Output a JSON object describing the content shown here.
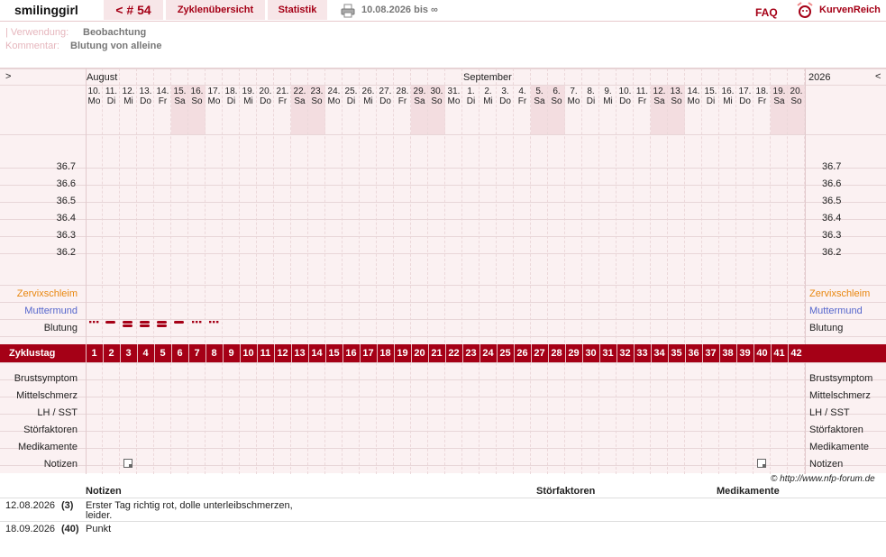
{
  "header": {
    "user": "smilinggirl",
    "cycle_button": "< # 54",
    "overview_button": "Zyklenübersicht",
    "stats_button": "Statistik",
    "print_icon": "printer-icon",
    "date_range": "10.08.2026 bis ∞",
    "faq": "FAQ",
    "brand_icon": "kurvenreich-logo-icon",
    "brand": "KurvenReich"
  },
  "meta": {
    "usage_label": "| Verwendung:",
    "usage_value": "Beobachtung",
    "comment_label": "Kommentar:",
    "comment_value": "Blutung von alleine"
  },
  "chart": {
    "nav_left": ">",
    "nav_right": "<",
    "months": [
      "August",
      "September"
    ],
    "year": "2026",
    "days": [
      {
        "d": "10.",
        "w": "Mo"
      },
      {
        "d": "11.",
        "w": "Di"
      },
      {
        "d": "12.",
        "w": "Mi"
      },
      {
        "d": "13.",
        "w": "Do"
      },
      {
        "d": "14.",
        "w": "Fr"
      },
      {
        "d": "15.",
        "w": "Sa"
      },
      {
        "d": "16.",
        "w": "So"
      },
      {
        "d": "17.",
        "w": "Mo"
      },
      {
        "d": "18.",
        "w": "Di"
      },
      {
        "d": "19.",
        "w": "Mi"
      },
      {
        "d": "20.",
        "w": "Do"
      },
      {
        "d": "21.",
        "w": "Fr"
      },
      {
        "d": "22.",
        "w": "Sa"
      },
      {
        "d": "23.",
        "w": "So"
      },
      {
        "d": "24.",
        "w": "Mo"
      },
      {
        "d": "25.",
        "w": "Di"
      },
      {
        "d": "26.",
        "w": "Mi"
      },
      {
        "d": "27.",
        "w": "Do"
      },
      {
        "d": "28.",
        "w": "Fr"
      },
      {
        "d": "29.",
        "w": "Sa"
      },
      {
        "d": "30.",
        "w": "So"
      },
      {
        "d": "31.",
        "w": "Mo"
      },
      {
        "d": "1.",
        "w": "Di"
      },
      {
        "d": "2.",
        "w": "Mi"
      },
      {
        "d": "3.",
        "w": "Do"
      },
      {
        "d": "4.",
        "w": "Fr"
      },
      {
        "d": "5.",
        "w": "Sa"
      },
      {
        "d": "6.",
        "w": "So"
      },
      {
        "d": "7.",
        "w": "Mo"
      },
      {
        "d": "8.",
        "w": "Di"
      },
      {
        "d": "9.",
        "w": "Mi"
      },
      {
        "d": "10.",
        "w": "Do"
      },
      {
        "d": "11.",
        "w": "Fr"
      },
      {
        "d": "12.",
        "w": "Sa"
      },
      {
        "d": "13.",
        "w": "So"
      },
      {
        "d": "14.",
        "w": "Mo"
      },
      {
        "d": "15.",
        "w": "Di"
      },
      {
        "d": "16.",
        "w": "Mi"
      },
      {
        "d": "17.",
        "w": "Do"
      },
      {
        "d": "18.",
        "w": "Fr"
      },
      {
        "d": "19.",
        "w": "Sa"
      },
      {
        "d": "20.",
        "w": "So"
      }
    ],
    "temperatures": [
      "36.7",
      "36.6",
      "36.5",
      "36.4",
      "36.3",
      "36.2"
    ],
    "rows_top": [
      {
        "label": "Zervixschleim",
        "color": "#e8870f"
      },
      {
        "label": "Muttermund",
        "color": "#5566cc"
      },
      {
        "label": "Blutung",
        "color": "#222222"
      }
    ],
    "cycle_label": "Zyklustag",
    "cycle_days": [
      "1",
      "2",
      "3",
      "4",
      "5",
      "6",
      "7",
      "8",
      "9",
      "10",
      "11",
      "12",
      "13",
      "14",
      "15",
      "16",
      "17",
      "18",
      "19",
      "20",
      "21",
      "22",
      "23",
      "24",
      "25",
      "26",
      "27",
      "28",
      "29",
      "30",
      "31",
      "32",
      "33",
      "34",
      "35",
      "36",
      "37",
      "38",
      "39",
      "40",
      "41",
      "42"
    ],
    "rows_bottom": [
      "Brustsymptom",
      "Mittelschmerz",
      "LH / SST",
      "Störfaktoren",
      "Medikamente",
      "Notizen"
    ],
    "bleeding": [
      {
        "cycle_day": 1,
        "type": "light"
      },
      {
        "cycle_day": 2,
        "type": "normal"
      },
      {
        "cycle_day": 3,
        "type": "heavy"
      },
      {
        "cycle_day": 4,
        "type": "heavy"
      },
      {
        "cycle_day": 5,
        "type": "heavy"
      },
      {
        "cycle_day": 6,
        "type": "normal"
      },
      {
        "cycle_day": 7,
        "type": "light"
      },
      {
        "cycle_day": 8,
        "type": "light"
      }
    ],
    "note_days": [
      3,
      40
    ],
    "colors": {
      "accent": "#a50016",
      "weekend": "#f3dde0",
      "grid_bg": "#fbf1f2"
    }
  },
  "notes": {
    "copyright": "© http://www.nfp-forum.de",
    "col_notes": "Notizen",
    "col_stoer": "Störfaktoren",
    "col_med": "Medikamente",
    "entries": [
      {
        "date": "12.08.2026",
        "day": "(3)",
        "text1": "Erster Tag richtig rot, dolle unterleibschmerzen,",
        "text2": "leider."
      },
      {
        "date": "18.09.2026",
        "day": "(40)",
        "text1": "Punkt",
        "text2": ""
      }
    ]
  }
}
